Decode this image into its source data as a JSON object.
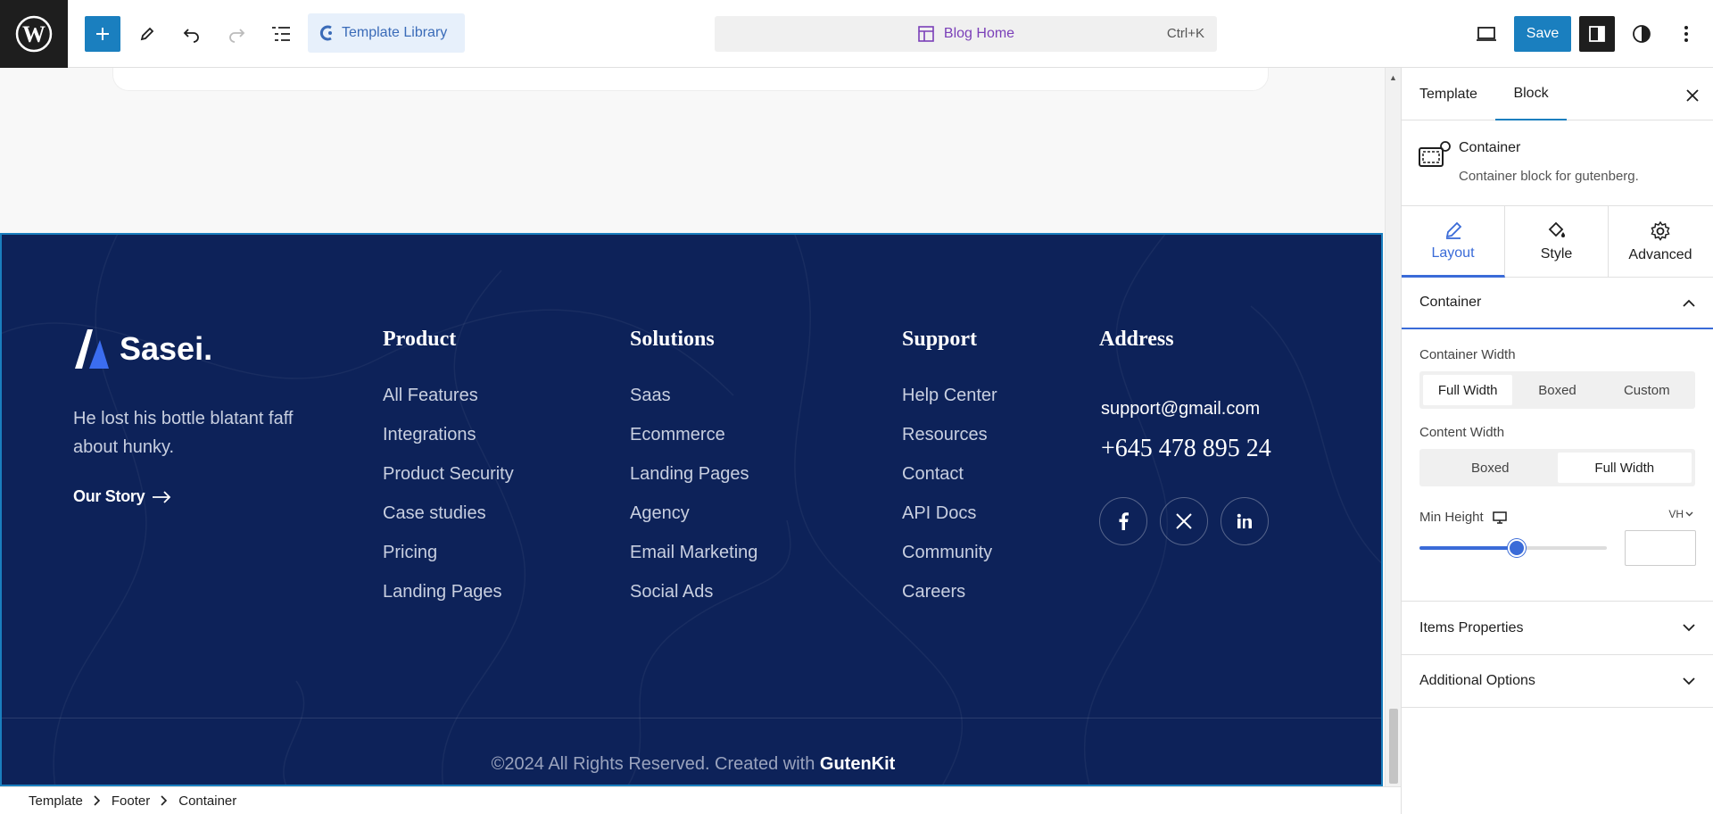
{
  "topbar": {
    "template_library_label": "Template Library",
    "document_title": "Blog Home",
    "command_shortcut": "Ctrl+K",
    "save_label": "Save"
  },
  "footer": {
    "brand_name": "Sasei.",
    "tagline": "He lost his bottle blatant faff about hunky.",
    "our_story_label": "Our Story",
    "columns": [
      {
        "heading": "Product",
        "items": [
          "All Features",
          "Integrations",
          "Product Security",
          "Case studies",
          "Pricing",
          "Landing Pages"
        ]
      },
      {
        "heading": "Solutions",
        "items": [
          "Saas",
          "Ecommerce",
          "Landing Pages",
          "Agency",
          "Email Marketing",
          "Social Ads"
        ]
      },
      {
        "heading": "Support",
        "items": [
          "Help Center",
          "Resources",
          "Contact",
          "API Docs",
          "Community",
          "Careers"
        ]
      }
    ],
    "address": {
      "heading": "Address",
      "email": "support@gmail.com",
      "phone": "+645 478 895 24"
    },
    "copyright_prefix": "©2024 All Rights Reserved. Created with ",
    "copyright_brand": "GutenKit"
  },
  "breadcrumb": [
    "Template",
    "Footer",
    "Container"
  ],
  "sidebar": {
    "tabs": [
      "Template",
      "Block"
    ],
    "block_name": "Container",
    "block_description": "Container block for gutenberg.",
    "inner_tabs": [
      "Layout",
      "Style",
      "Advanced"
    ],
    "panel_title": "Container",
    "container_width_label": "Container Width",
    "container_width_options": [
      "Full Width",
      "Boxed",
      "Custom"
    ],
    "content_width_label": "Content Width",
    "content_width_options": [
      "Boxed",
      "Full Width"
    ],
    "min_height_label": "Min Height",
    "min_height_unit": "VH",
    "min_height_slider_fraction": 0.52,
    "sections": [
      "Items Properties",
      "Additional Options"
    ]
  },
  "colors": {
    "accent": "#1a7fbf",
    "footer_bg": "#0d2259",
    "panel_accent": "#3a6bd8"
  }
}
